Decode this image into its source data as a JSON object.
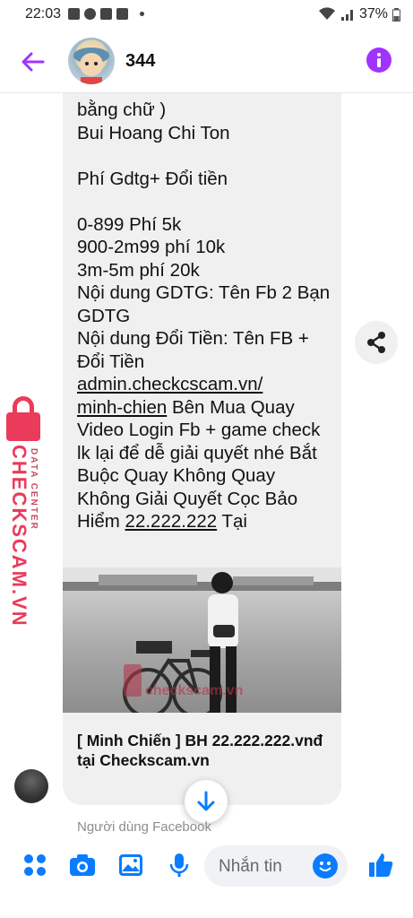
{
  "status_bar": {
    "time": "22:03",
    "battery": "37%"
  },
  "header": {
    "title": "344",
    "icons": [
      "back-arrow-icon",
      "avatar",
      "info-icon"
    ],
    "accent_color": "#a033ff"
  },
  "message": {
    "text": "bằng chữ )\nBui Hoang Chi Ton\n\nPhí Gdtg+ Đổi tiền\n\n0-899 Phí 5k\n900-2m99 phí 10k\n3m-5m phí 20k\nNội dung GDTG: Tên Fb 2 Bạn GDTG\nNội dung Đổi Tiền: Tên FB + Đổi Tiền",
    "link_1": "admin.checkcscam.vn/\nminh-chien",
    "text_2": " Bên Mua Quay Video Login Fb + game check lk lại để dễ giải quyết nhé Bắt Buộc Quay Không Quay Không Giải Quyết Cọc Bảo Hiểm ",
    "link_2": "22.222.222",
    "text_3": " Tại",
    "photo_watermark": "checkscam.vn",
    "caption": "[ Minh Chiến ] BH 22.222.222.vnđ tại Checkscam.vn"
  },
  "footer_note": "Người dùng Facebook",
  "composer": {
    "placeholder": "Nhắn tin",
    "brand_color": "#0a7cff"
  },
  "watermark": {
    "main": "CHECKSCAM.VN",
    "sub": "DATA CENTER"
  }
}
